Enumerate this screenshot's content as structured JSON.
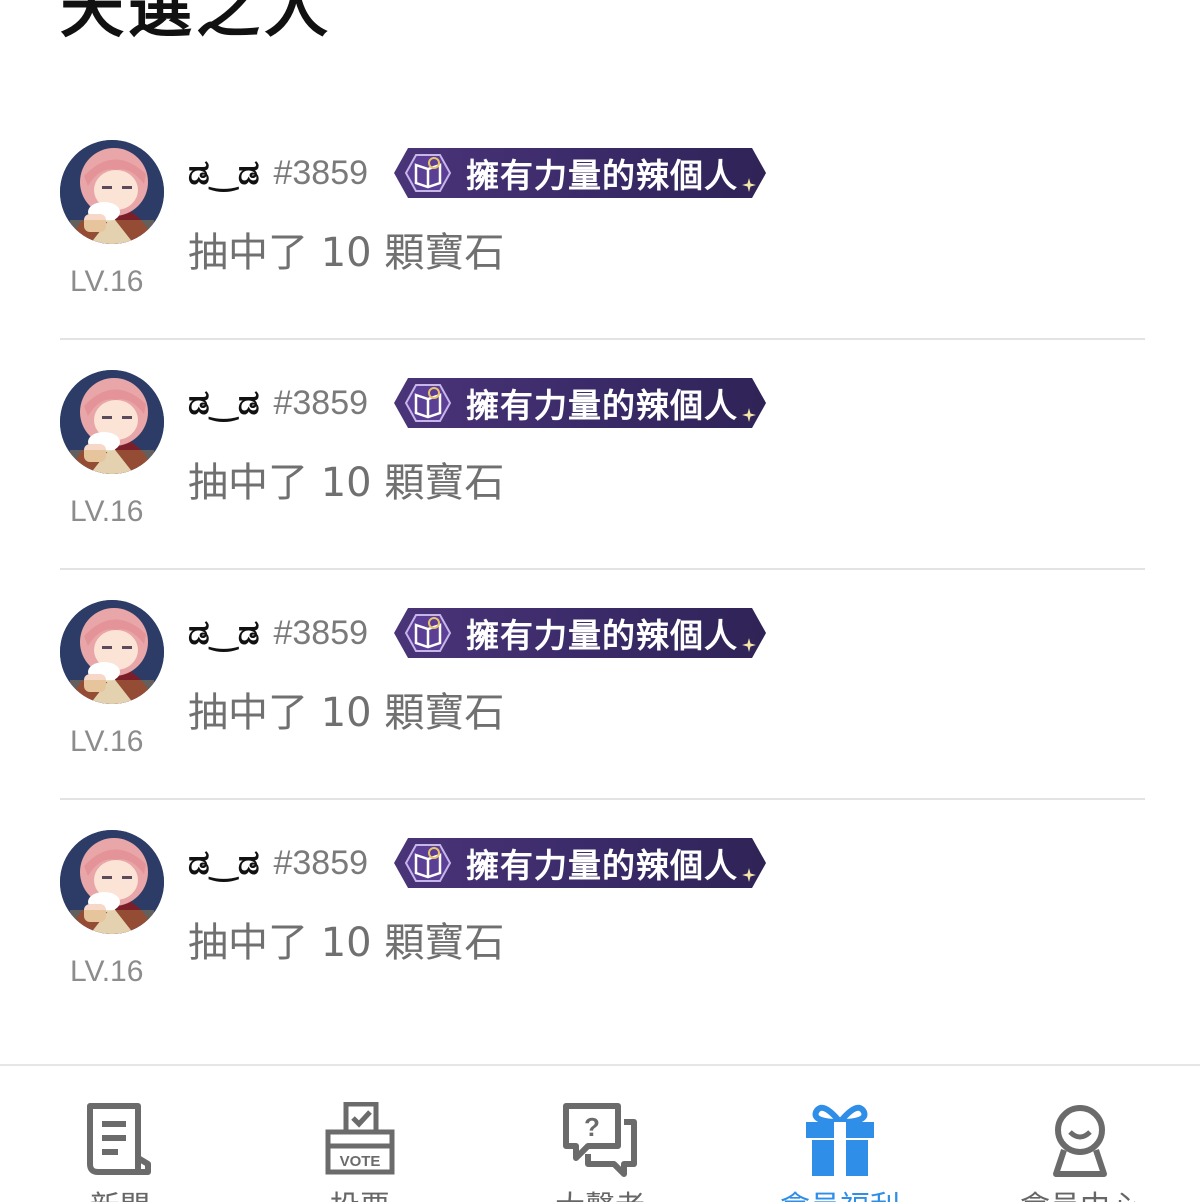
{
  "page": {
    "title": "天選之人"
  },
  "winners": [
    {
      "level": "LV.16",
      "username": "ಡ‿ಡ",
      "user_id": "#3859",
      "title_badge": "擁有力量的辣個人",
      "prize": "抽中了 10 顆寶石"
    },
    {
      "level": "LV.16",
      "username": "ಡ‿ಡ",
      "user_id": "#3859",
      "title_badge": "擁有力量的辣個人",
      "prize": "抽中了 10 顆寶石"
    },
    {
      "level": "LV.16",
      "username": "ಡ‿ಡ",
      "user_id": "#3859",
      "title_badge": "擁有力量的辣個人",
      "prize": "抽中了 10 顆寶石"
    },
    {
      "level": "LV.16",
      "username": "ಡ‿ಡ",
      "user_id": "#3859",
      "title_badge": "擁有力量的辣個人",
      "prize": "抽中了 10 顆寶石"
    }
  ],
  "bottom_nav": {
    "items": [
      {
        "label": "新聞",
        "icon": "news-icon"
      },
      {
        "label": "投票",
        "icon": "vote-icon"
      },
      {
        "label": "大聲者",
        "icon": "question-icon"
      },
      {
        "label": "會員福利",
        "icon": "gift-icon",
        "active": true
      },
      {
        "label": "會員中心",
        "icon": "member-icon"
      }
    ]
  },
  "colors": {
    "active_tab": "#2f8ee8",
    "badge_bg": "#3a2a68",
    "divider": "#e3e3e3"
  }
}
